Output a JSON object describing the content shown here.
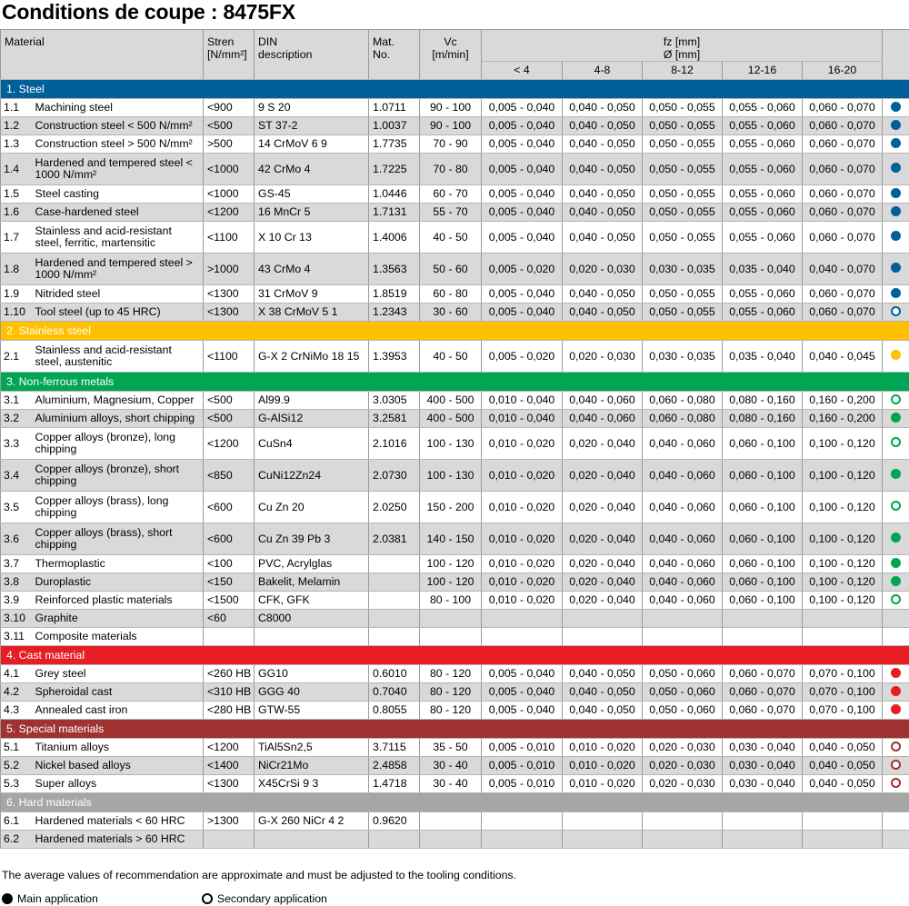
{
  "title": "Conditions de coupe : 8475FX",
  "header": {
    "material": "Material",
    "strength": [
      "Stren",
      "[N/mm²]"
    ],
    "din": [
      "DIN",
      "description"
    ],
    "matno": [
      "Mat.",
      "No."
    ],
    "vc": [
      "Vc",
      "[m/min]"
    ],
    "fz": [
      "fz [mm]",
      "Ø [mm]"
    ],
    "ranges": [
      "< 4",
      "4-8",
      "8-12",
      "12-16",
      "16-20"
    ]
  },
  "colors": {
    "steel": "#00609a",
    "stainless": "#ffc000",
    "nonferrous": "#00a651",
    "cast": "#e61e24",
    "special": "#a03232",
    "hard": "#a6a6a6"
  },
  "sections": [
    {
      "title": "1. Steel",
      "color": "#00609a",
      "rows": [
        {
          "no": "1.1",
          "material": "Machining steel",
          "strength": "<900",
          "din": "9 S 20",
          "matno": "1.0711",
          "vc": "90 - 100",
          "fz": [
            "0,005 - 0,040",
            "0,040 - 0,050",
            "0,050 - 0,055",
            "0,055 - 0,060",
            "0,060 - 0,070"
          ],
          "app": "main"
        },
        {
          "no": "1.2",
          "material": "Construction steel < 500 N/mm²",
          "strength": "<500",
          "din": "ST 37-2",
          "matno": "1.0037",
          "vc": "90 - 100",
          "fz": [
            "0,005 - 0,040",
            "0,040 - 0,050",
            "0,050 - 0,055",
            "0,055 - 0,060",
            "0,060 - 0,070"
          ],
          "app": "main"
        },
        {
          "no": "1.3",
          "material": "Construction steel > 500 N/mm²",
          "strength": ">500",
          "din": "14 CrMoV 6 9",
          "matno": "1.7735",
          "vc": "70 - 90",
          "fz": [
            "0,005 - 0,040",
            "0,040 - 0,050",
            "0,050 - 0,055",
            "0,055 - 0,060",
            "0,060 - 0,070"
          ],
          "app": "main"
        },
        {
          "no": "1.4",
          "material": "Hardened and tempered steel < 1000 N/mm²",
          "strength": "<1000",
          "din": "42 CrMo 4",
          "matno": "1.7225",
          "vc": "70 - 80",
          "fz": [
            "0,005 - 0,040",
            "0,040 - 0,050",
            "0,050 - 0,055",
            "0,055 - 0,060",
            "0,060 - 0,070"
          ],
          "app": "main",
          "tall": true
        },
        {
          "no": "1.5",
          "material": "Steel casting",
          "strength": "<1000",
          "din": "GS-45",
          "matno": "1.0446",
          "vc": "60 - 70",
          "fz": [
            "0,005 - 0,040",
            "0,040 - 0,050",
            "0,050 - 0,055",
            "0,055 - 0,060",
            "0,060 - 0,070"
          ],
          "app": "main"
        },
        {
          "no": "1.6",
          "material": "Case-hardened steel",
          "strength": "<1200",
          "din": "16 MnCr 5",
          "matno": "1.7131",
          "vc": "55 - 70",
          "fz": [
            "0,005 - 0,040",
            "0,040 - 0,050",
            "0,050 - 0,055",
            "0,055 - 0,060",
            "0,060 - 0,070"
          ],
          "app": "main"
        },
        {
          "no": "1.7",
          "material": "Stainless and acid-resistant steel, ferritic, martensitic",
          "strength": "<1100",
          "din": "X 10 Cr 13",
          "matno": "1.4006",
          "vc": "40 - 50",
          "fz": [
            "0,005 - 0,040",
            "0,040 - 0,050",
            "0,050 - 0,055",
            "0,055 - 0,060",
            "0,060 - 0,070"
          ],
          "app": "main",
          "tall": true
        },
        {
          "no": "1.8",
          "material": "Hardened and tempered steel > 1000 N/mm²",
          "strength": ">1000",
          "din": "43 CrMo 4",
          "matno": "1.3563",
          "vc": "50 - 60",
          "fz": [
            "0,005 - 0,020",
            "0,020 - 0,030",
            "0,030 - 0,035",
            "0,035 - 0,040",
            "0,040 - 0,070"
          ],
          "app": "main",
          "tall": true
        },
        {
          "no": "1.9",
          "material": "Nitrided steel",
          "strength": "<1300",
          "din": "31 CrMoV 9",
          "matno": "1.8519",
          "vc": "60 - 80",
          "fz": [
            "0,005 - 0,040",
            "0,040 - 0,050",
            "0,050 - 0,055",
            "0,055 - 0,060",
            "0,060 - 0,070"
          ],
          "app": "main"
        },
        {
          "no": "1.10",
          "material": "Tool steel (up to 45 HRC)",
          "strength": "<1300",
          "din": "X 38 CrMoV 5 1",
          "matno": "1.2343",
          "vc": "30 - 60",
          "fz": [
            "0,005 - 0,040",
            "0,040 - 0,050",
            "0,050 - 0,055",
            "0,055 - 0,060",
            "0,060 - 0,070"
          ],
          "app": "secondary"
        }
      ]
    },
    {
      "title": "2. Stainless steel",
      "color": "#ffc000",
      "rows": [
        {
          "no": "2.1",
          "material": "Stainless and acid-resistant steel, austenitic",
          "strength": "<1100",
          "din": "G-X 2 CrNiMo 18 15",
          "matno": "1.3953",
          "vc": "40 - 50",
          "fz": [
            "0,005 - 0,020",
            "0,020 - 0,030",
            "0,030 - 0,035",
            "0,035 - 0,040",
            "0,040 - 0,045"
          ],
          "app": "main",
          "tall": true
        }
      ]
    },
    {
      "title": "3. Non-ferrous metals",
      "color": "#00a651",
      "rows": [
        {
          "no": "3.1",
          "material": "Aluminium, Magnesium, Copper",
          "strength": "<500",
          "din": "Al99.9",
          "matno": "3.0305",
          "vc": "400 - 500",
          "fz": [
            "0,010 - 0,040",
            "0,040 - 0,060",
            "0,060 - 0,080",
            "0,080 - 0,160",
            "0,160 - 0,200"
          ],
          "app": "secondary"
        },
        {
          "no": "3.2",
          "material": "Aluminium alloys, short chipping",
          "strength": "<500",
          "din": "G-AlSi12",
          "matno": "3.2581",
          "vc": "400 - 500",
          "fz": [
            "0,010 - 0,040",
            "0,040 - 0,060",
            "0,060 - 0,080",
            "0,080 - 0,160",
            "0,160 - 0,200"
          ],
          "app": "main"
        },
        {
          "no": "3.3",
          "material": "Copper alloys (bronze), long chipping",
          "strength": "<1200",
          "din": "CuSn4",
          "matno": "2.1016",
          "vc": "100 - 130",
          "fz": [
            "0,010 - 0,020",
            "0,020 - 0,040",
            "0,040 - 0,060",
            "0,060 - 0,100",
            "0,100 - 0,120"
          ],
          "app": "secondary",
          "tall": true
        },
        {
          "no": "3.4",
          "material": "Copper alloys (bronze), short chipping",
          "strength": "<850",
          "din": "CuNi12Zn24",
          "matno": "2.0730",
          "vc": "100 - 130",
          "fz": [
            "0,010 - 0,020",
            "0,020 - 0,040",
            "0,040 - 0,060",
            "0,060 - 0,100",
            "0,100 - 0,120"
          ],
          "app": "main",
          "tall": true
        },
        {
          "no": "3.5",
          "material": "Copper alloys (brass), long chipping",
          "strength": "<600",
          "din": "Cu Zn 20",
          "matno": "2.0250",
          "vc": "150 - 200",
          "fz": [
            "0,010 - 0,020",
            "0,020 - 0,040",
            "0,040 - 0,060",
            "0,060 - 0,100",
            "0,100 - 0,120"
          ],
          "app": "secondary",
          "tall": true
        },
        {
          "no": "3.6",
          "material": "Copper alloys (brass), short chipping",
          "strength": "<600",
          "din": "Cu Zn 39 Pb 3",
          "matno": "2.0381",
          "vc": "140 - 150",
          "fz": [
            "0,010 - 0,020",
            "0,020 - 0,040",
            "0,040 - 0,060",
            "0,060 - 0,100",
            "0,100 - 0,120"
          ],
          "app": "main",
          "tall": true
        },
        {
          "no": "3.7",
          "material": "Thermoplastic",
          "strength": "<100",
          "din": "PVC, Acrylglas",
          "matno": "",
          "vc": "100 - 120",
          "fz": [
            "0,010 - 0,020",
            "0,020 - 0,040",
            "0,040 - 0,060",
            "0,060 - 0,100",
            "0,100 - 0,120"
          ],
          "app": "main"
        },
        {
          "no": "3.8",
          "material": "Duroplastic",
          "strength": "<150",
          "din": "Bakelit, Melamin",
          "matno": "",
          "vc": "100 - 120",
          "fz": [
            "0,010 - 0,020",
            "0,020 - 0,040",
            "0,040 - 0,060",
            "0,060 - 0,100",
            "0,100 - 0,120"
          ],
          "app": "main"
        },
        {
          "no": "3.9",
          "material": "Reinforced plastic materials",
          "strength": "<1500",
          "din": "CFK, GFK",
          "matno": "",
          "vc": "80 - 100",
          "fz": [
            "0,010 - 0,020",
            "0,020 - 0,040",
            "0,040 - 0,060",
            "0,060 - 0,100",
            "0,100 - 0,120"
          ],
          "app": "secondary"
        },
        {
          "no": "3.10",
          "material": "Graphite",
          "strength": "<60",
          "din": "C8000",
          "matno": "",
          "vc": "",
          "fz": [
            "",
            "",
            "",
            "",
            ""
          ],
          "app": ""
        },
        {
          "no": "3.11",
          "material": "Composite materials",
          "strength": "",
          "din": "",
          "matno": "",
          "vc": "",
          "fz": [
            "",
            "",
            "",
            "",
            ""
          ],
          "app": ""
        }
      ]
    },
    {
      "title": "4. Cast material",
      "color": "#e61e24",
      "rows": [
        {
          "no": "4.1",
          "material": "Grey steel",
          "strength": "<260 HB",
          "din": "GG10",
          "matno": "0.6010",
          "vc": "80 - 120",
          "fz": [
            "0,005 - 0,040",
            "0,040 - 0,050",
            "0,050 - 0,060",
            "0,060 - 0,070",
            "0,070 - 0,100"
          ],
          "app": "main"
        },
        {
          "no": "4.2",
          "material": "Spheroidal cast",
          "strength": "<310 HB",
          "din": "GGG 40",
          "matno": "0.7040",
          "vc": "80 - 120",
          "fz": [
            "0,005 - 0,040",
            "0,040 - 0,050",
            "0,050 - 0,060",
            "0,060 - 0,070",
            "0,070 - 0,100"
          ],
          "app": "main"
        },
        {
          "no": "4.3",
          "material": "Annealed cast iron",
          "strength": "<280 HB",
          "din": "GTW-55",
          "matno": "0.8055",
          "vc": "80 - 120",
          "fz": [
            "0,005 - 0,040",
            "0,040 - 0,050",
            "0,050 - 0,060",
            "0,060 - 0,070",
            "0,070 - 0,100"
          ],
          "app": "main"
        }
      ]
    },
    {
      "title": "5. Special materials",
      "color": "#a03232",
      "rows": [
        {
          "no": "5.1",
          "material": "Titanium alloys",
          "strength": "<1200",
          "din": "TiAl5Sn2,5",
          "matno": "3.7115",
          "vc": "35 - 50",
          "fz": [
            "0,005 - 0,010",
            "0,010 - 0,020",
            "0,020 - 0,030",
            "0,030 - 0,040",
            "0,040 - 0,050"
          ],
          "app": "secondary"
        },
        {
          "no": "5.2",
          "material": "Nickel based alloys",
          "strength": "<1400",
          "din": "NiCr21Mo",
          "matno": "2.4858",
          "vc": "30 - 40",
          "fz": [
            "0,005 - 0,010",
            "0,010 - 0,020",
            "0,020 - 0,030",
            "0,030 - 0,040",
            "0,040 - 0,050"
          ],
          "app": "secondary"
        },
        {
          "no": "5.3",
          "material": "Super alloys",
          "strength": "<1300",
          "din": "X45CrSi 9 3",
          "matno": "1.4718",
          "vc": "30 - 40",
          "fz": [
            "0,005 - 0,010",
            "0,010 - 0,020",
            "0,020 - 0,030",
            "0,030 - 0,040",
            "0,040 - 0,050"
          ],
          "app": "secondary"
        }
      ]
    },
    {
      "title": "6. Hard materials",
      "color": "#a6a6a6",
      "rows": [
        {
          "no": "6.1",
          "material": "Hardened materials < 60 HRC",
          "strength": ">1300",
          "din": "G-X 260 NiCr 4 2",
          "matno": "0.9620",
          "vc": "",
          "fz": [
            "",
            "",
            "",
            "",
            ""
          ],
          "app": ""
        },
        {
          "no": "6.2",
          "material": "Hardened materials > 60 HRC",
          "strength": "",
          "din": "",
          "matno": "",
          "vc": "",
          "fz": [
            "",
            "",
            "",
            "",
            ""
          ],
          "app": ""
        }
      ]
    }
  ],
  "note": "The average values of recommendation are approximate and must be adjusted to the tooling conditions.",
  "legend": {
    "main": "Main application",
    "secondary": "Secondary application"
  }
}
